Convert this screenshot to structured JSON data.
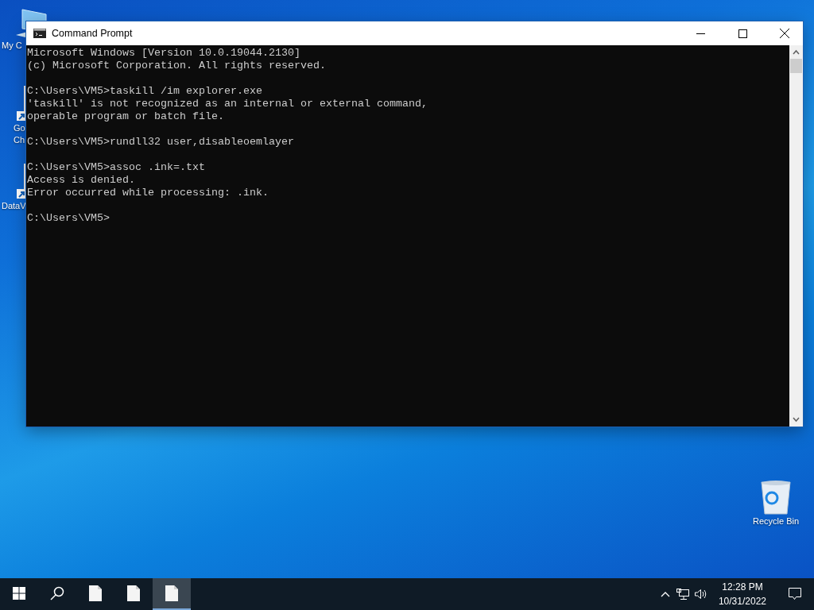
{
  "desktop_icons": [
    {
      "kind": "computer",
      "label_lines": [
        "My C"
      ]
    },
    {
      "kind": "shortcut",
      "label_lines": [
        "Go",
        "Ch"
      ]
    },
    {
      "kind": "shortcut",
      "label_lines": [
        "DataV"
      ]
    },
    {
      "kind": "recycle",
      "label_lines": [
        "Recycle Bin"
      ]
    }
  ],
  "window": {
    "title": "Command Prompt",
    "console_blocks": [
      [
        "Microsoft Windows [Version 10.0.19044.2130]",
        "(c) Microsoft Corporation. All rights reserved."
      ],
      [
        "C:\\Users\\VM5>taskill /im explorer.exe",
        "'taskill' is not recognized as an internal or external command,",
        "operable program or batch file."
      ],
      [
        "C:\\Users\\VM5>rundll32 user,disableoemlayer"
      ],
      [
        "C:\\Users\\VM5>assoc .ink=.txt",
        "Access is denied.",
        "Error occurred while processing: .ink."
      ],
      [
        "C:\\Users\\VM5>"
      ]
    ]
  },
  "taskbar": {
    "apps": [
      {
        "kind": "start",
        "selected": false
      },
      {
        "kind": "search",
        "selected": false
      },
      {
        "kind": "file",
        "selected": false
      },
      {
        "kind": "file",
        "selected": false
      },
      {
        "kind": "file",
        "selected": true
      }
    ],
    "clock": {
      "time": "12:28 PM",
      "date": "10/31/2022"
    }
  }
}
